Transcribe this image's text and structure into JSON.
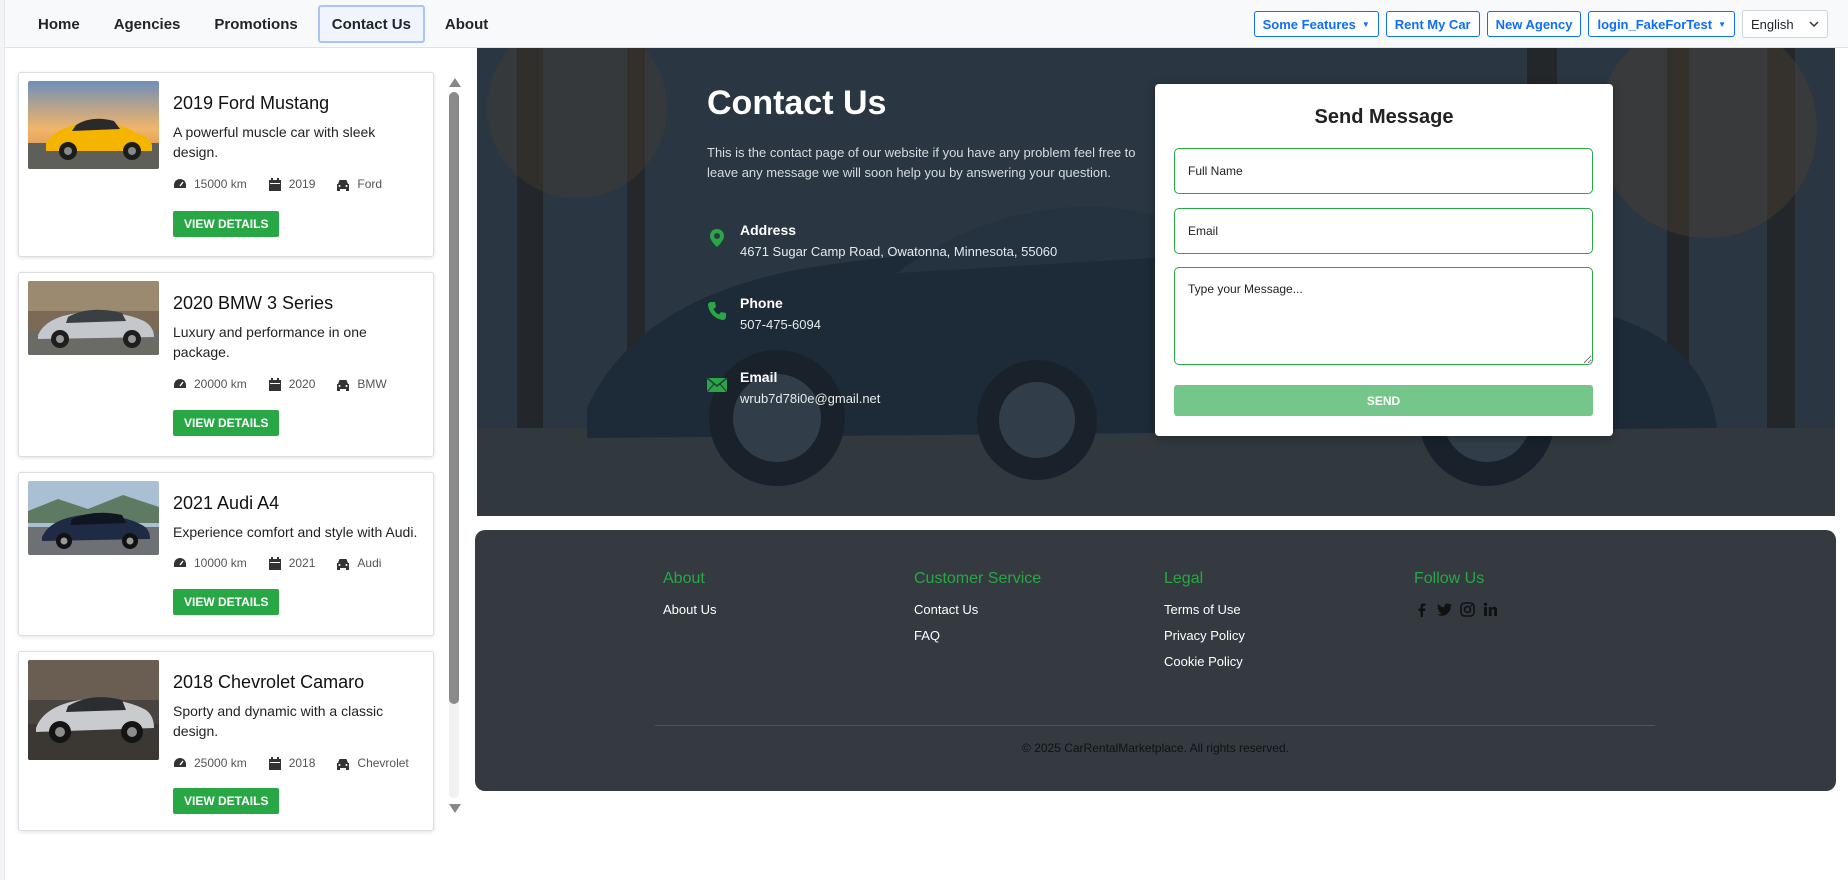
{
  "nav": {
    "links": [
      "Home",
      "Agencies",
      "Promotions",
      "Contact Us",
      "About"
    ],
    "active": "Contact Us",
    "buttons": {
      "features": "Some Features",
      "rent": "Rent My Car",
      "agency": "New Agency",
      "login": "login_FakeForTest"
    },
    "language": "English"
  },
  "cars": [
    {
      "title": "2019 Ford Mustang",
      "description": "A powerful muscle car with sleek design.",
      "km": "15000 km",
      "year": "2019",
      "brand": "Ford",
      "button": "VIEW DETAILS"
    },
    {
      "title": "2020 BMW 3 Series",
      "description": "Luxury and performance in one package.",
      "km": "20000 km",
      "year": "2020",
      "brand": "BMW",
      "button": "VIEW DETAILS"
    },
    {
      "title": "2021 Audi A4",
      "description": "Experience comfort and style with Audi.",
      "km": "10000 km",
      "year": "2021",
      "brand": "Audi",
      "button": "VIEW DETAILS"
    },
    {
      "title": "2018 Chevrolet Camaro",
      "description": "Sporty and dynamic with a classic design.",
      "km": "25000 km",
      "year": "2018",
      "brand": "Chevrolet",
      "button": "VIEW DETAILS"
    }
  ],
  "contact": {
    "title": "Contact Us",
    "intro": "This is the contact page of our website if you have any problem feel free to leave any message we will soon help you by answering your question.",
    "address_label": "Address",
    "address": "4671 Sugar Camp Road, Owatonna, Minnesota, 55060",
    "phone_label": "Phone",
    "phone": "507-475-6094",
    "email_label": "Email",
    "email": "wrub7d78i0e@gmail.net"
  },
  "form": {
    "title": "Send Message",
    "name_placeholder": "Full Name",
    "email_placeholder": "Email",
    "message_placeholder": "Type your Message...",
    "send": "SEND"
  },
  "footer": {
    "about": {
      "heading": "About",
      "links": [
        "About Us"
      ]
    },
    "service": {
      "heading": "Customer Service",
      "links": [
        "Contact Us",
        "FAQ"
      ]
    },
    "legal": {
      "heading": "Legal",
      "links": [
        "Terms of Use",
        "Privacy Policy",
        "Cookie Policy"
      ]
    },
    "follow": {
      "heading": "Follow Us",
      "icons": [
        "facebook-icon",
        "twitter-icon",
        "instagram-icon",
        "linkedin-icon"
      ]
    },
    "copyright": "© 2025 CarRentalMarketplace. All rights reserved."
  },
  "colors": {
    "accent": "#28a745",
    "primary": "#0d6efd",
    "footer_bg": "#343a40"
  }
}
